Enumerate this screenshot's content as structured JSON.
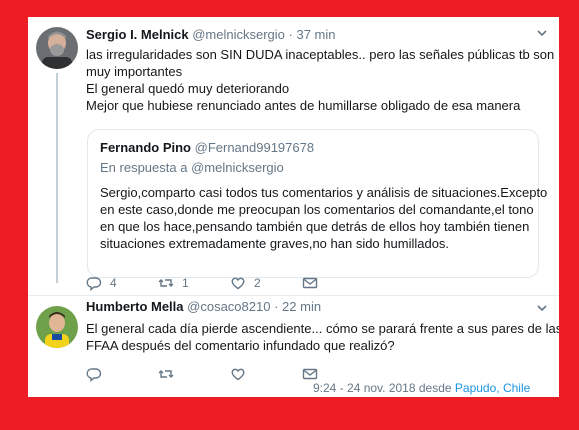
{
  "tweet1": {
    "display_name": "Sergio I. Melnick",
    "handle": "@melnicksergio",
    "separator": "·",
    "time": "37 min",
    "lines": [
      "las irregularidades son SIN DUDA  inaceptables.. pero las señales públicas tb son",
      "muy importantes",
      "El general quedó muy deteriorando",
      "Mejor que hubiese renunciado antes de humillarse obligado de esa manera"
    ],
    "replies": "4",
    "retweets": "1",
    "likes": "2"
  },
  "quote": {
    "display_name": "Fernando Pino",
    "handle": "@Fernand99197678",
    "reply_prefix": "En respuesta a",
    "reply_to": "@melnicksergio",
    "lines": [
      "Sergio,comparto casi todos tus comentarios y análisis de situaciones.Excepto",
      "en este caso,donde me preocupan los comentarios del comandante,el tono",
      "en que los hace,pensando también que detrás de ellos hoy también tienen",
      "situaciones extremadamente graves,no han sido humillados."
    ]
  },
  "tweet2": {
    "display_name": "Humberto Mella",
    "handle": "@cosaco8210",
    "separator": "·",
    "time": "22 min",
    "lines": [
      "El general cada día pierde ascendiente... cómo se parará frente a sus pares de las",
      "FFAA después del comentario infundado que realizó?"
    ]
  },
  "footer": {
    "timestamp": "9:24 - 24 nov. 2018 desde",
    "place": "Papudo, Chile"
  },
  "icons": {
    "reply": "reply-icon",
    "retweet": "retweet-icon",
    "like": "like-icon",
    "dm": "direct-message-icon",
    "menu": "chevron-down-icon"
  }
}
